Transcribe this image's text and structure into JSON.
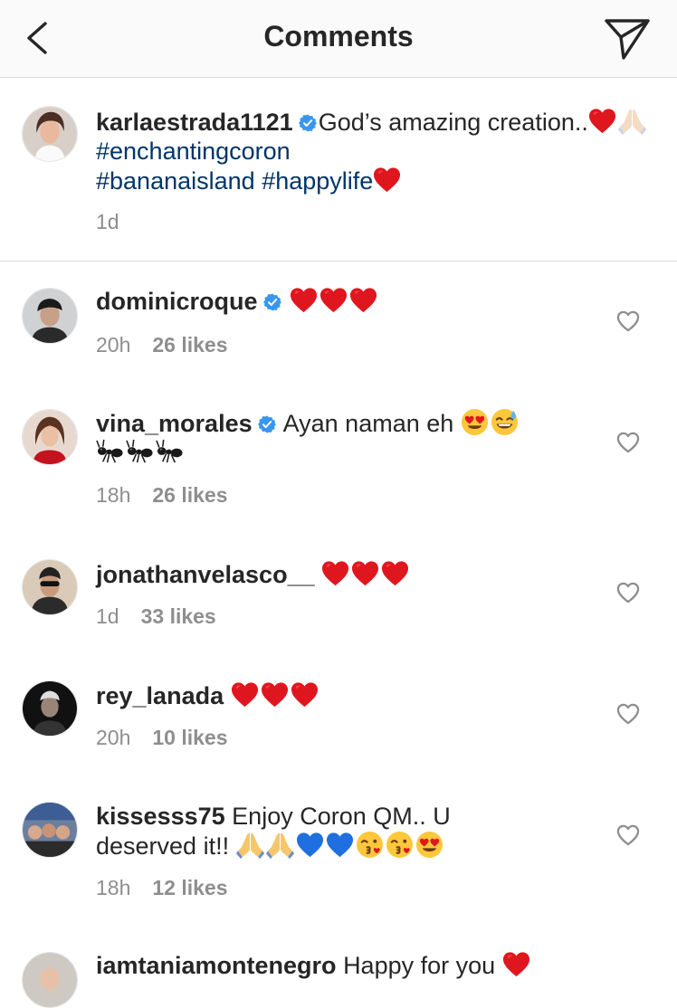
{
  "header": {
    "title": "Comments"
  },
  "caption": {
    "username": "karlaestrada1121",
    "text_1": "God’s amazing creation..",
    "hashtag_1": "#enchantingcoron",
    "hashtag_2": "#bananaisland",
    "hashtag_3": "#happylife",
    "time": "1d"
  },
  "comments": [
    {
      "username": "dominicroque",
      "time": "20h",
      "likes": "26 likes"
    },
    {
      "username": "vina_morales",
      "text": "Ayan naman eh",
      "time": "18h",
      "likes": "26 likes"
    },
    {
      "username": "jonathanvelasco__",
      "time": "1d",
      "likes": "33 likes"
    },
    {
      "username": "rey_lanada",
      "time": "20h",
      "likes": "10 likes"
    },
    {
      "username": "kissesss75",
      "text": "Enjoy Coron QM.. U",
      "text_2": "deserved it!!",
      "time": "18h",
      "likes": "12 likes"
    },
    {
      "username": "iamtaniamontenegro",
      "text": "Happy for you"
    }
  ],
  "colors": {
    "hashtag": "#003569",
    "verified": "#3897f0",
    "heart": "#e0161f",
    "meta": "#8e8e8e"
  },
  "icons": [
    "back-chevron-icon",
    "direct-send-icon",
    "verified-badge-icon",
    "like-heart-icon"
  ]
}
